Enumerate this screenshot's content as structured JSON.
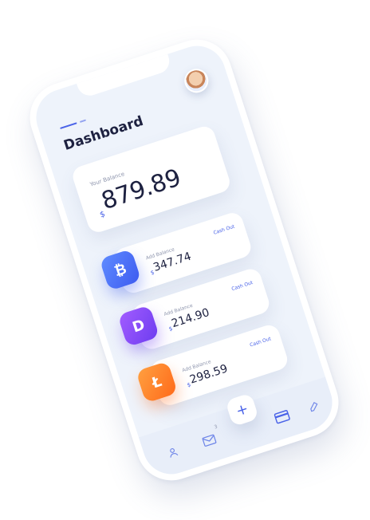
{
  "header": {
    "title": "Dashboard"
  },
  "balance": {
    "label": "Your Balance",
    "currency": "$",
    "amount": "879.89"
  },
  "coins": [
    {
      "icon": "bitcoin-icon",
      "glyph": "₿",
      "label": "Add Balance",
      "currency": "$",
      "amount": "347.74",
      "action": "Cash Out"
    },
    {
      "icon": "dash-icon",
      "glyph": "D",
      "label": "Add Balance",
      "currency": "$",
      "amount": "214.90",
      "action": "Cash Out"
    },
    {
      "icon": "litecoin-icon",
      "glyph": "Ł",
      "label": "Add Balance",
      "currency": "$",
      "amount": "298.59",
      "action": "Cash Out"
    }
  ],
  "nav": {
    "profile_icon": "user-icon",
    "mail_icon": "mail-icon",
    "mail_badge": "3",
    "add_label": "+",
    "wallet_icon": "card-icon",
    "edit_icon": "edit-icon"
  },
  "colors": {
    "accent": "#4a63e8",
    "bitcoin": "#3d5bf0",
    "dash": "#7d45f5",
    "litecoin": "#ff7a24"
  }
}
